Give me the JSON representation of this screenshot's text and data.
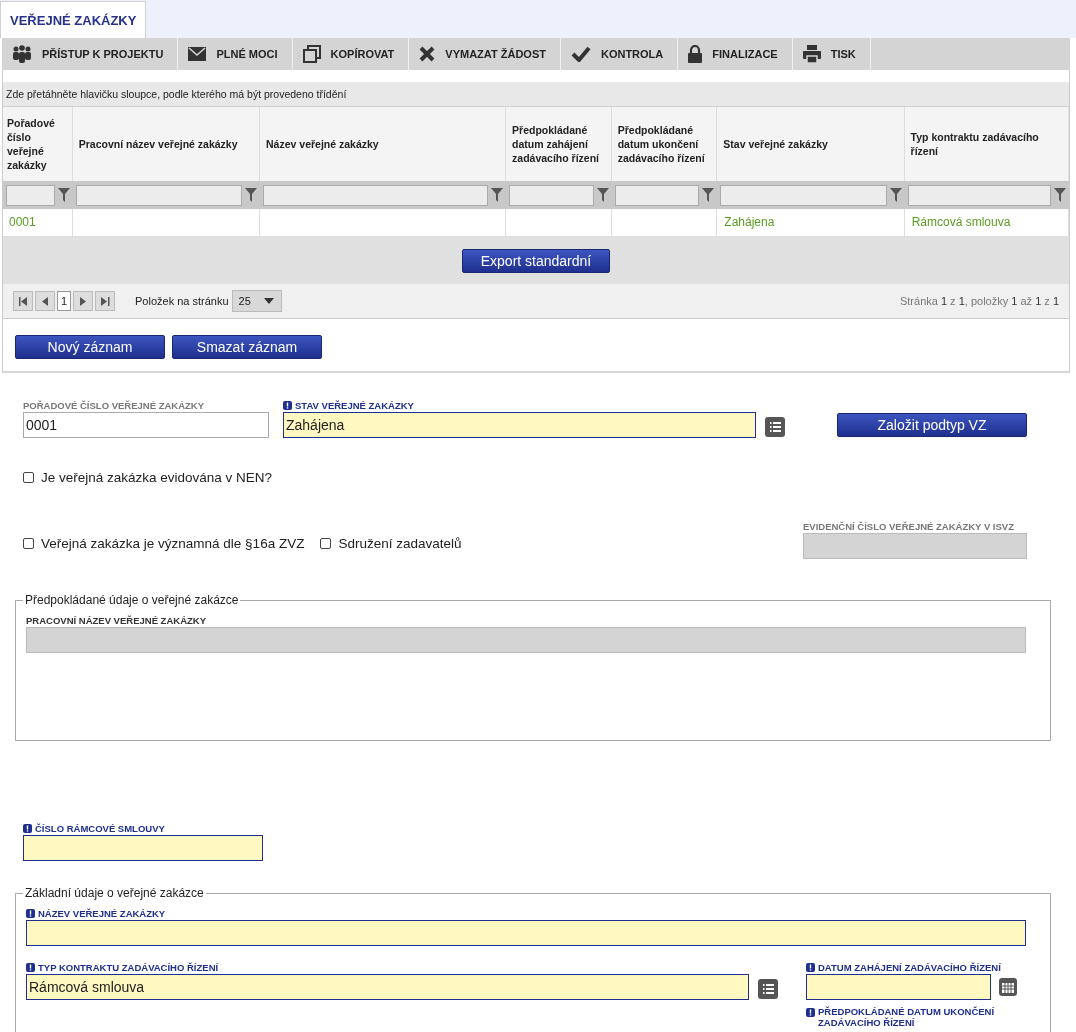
{
  "section_tab": {
    "label": "VEŘEJNÉ ZAKÁZKY",
    "selected": true
  },
  "toolbar": [
    {
      "label": "PŘÍSTUP K PROJEKTU",
      "kind": "people"
    },
    {
      "label": "PLNÉ MOCI",
      "kind": "mail"
    },
    {
      "label": "KOPÍROVAT",
      "kind": "copy"
    },
    {
      "label": "VYMAZAT ŽÁDOST",
      "kind": "delete"
    },
    {
      "label": "KONTROLA",
      "kind": "check"
    },
    {
      "label": "FINALIZACE",
      "kind": "lock"
    },
    {
      "label": "TISK",
      "kind": "print"
    }
  ],
  "grid": {
    "group_hint": "Zde přetáhněte hlavičku sloupce, podle kterého má být provedeno třídění",
    "columns": [
      "Pořadové číslo veřejné zakázky",
      "Pracovní název veřejné zakázky",
      "Název veřejné zakázky",
      "Předpokládané datum zahájení zadávacího řízení",
      "Předpokládané datum ukončení zadávacího řízení",
      "Stav veřejné zakázky",
      "Typ kontraktu zadávacího řízení"
    ],
    "rows": [
      [
        "0001",
        "",
        "",
        "",
        "",
        "Zahájena",
        "Rámcová smlouva"
      ]
    ],
    "export_button": "Export standardní",
    "pager": {
      "page": "1",
      "per_page_label": "Položek na stránku",
      "per_page": "25",
      "summary": "Stránka **1** z **1**, položky **1** až **1** z **1**"
    }
  },
  "actions": [
    "Nový záznam",
    "Smazat záznam"
  ],
  "form": {
    "order_number": {
      "label": "POŘADOVÉ ČÍSLO VEŘEJNÉ ZAKÁZKY",
      "value": "0001",
      "required": false
    },
    "status": {
      "label": "STAV VEŘEJNÉ ZAKÁZKY",
      "value": "Zahájena",
      "required": true
    },
    "subtype_button": "Založit podtyp VZ",
    "nen_checkbox": {
      "label": "Je veřejná zakázka evidována v NEN?",
      "checked": false
    },
    "significant_checkbox": {
      "label": "Veřejná zakázka je významná dle §16a ZVZ",
      "checked": false
    },
    "association_checkbox": {
      "label": "Sdružení zadavatelů",
      "checked": false
    },
    "isvz_number": {
      "label": "EVIDENČNÍ ČÍSLO VEŘEJNÉ ZAKÁZKY V ISVZ",
      "required": false
    },
    "expected_section": {
      "legend": "Předpokládané údaje o veřejné zakázce",
      "working_name": {
        "label": "PRACOVNÍ NÁZEV VEŘEJNÉ ZAKÁZKY",
        "required": false
      }
    },
    "framework_number": {
      "label": "ČÍSLO RÁMCOVÉ SMLOUVY",
      "required": true
    },
    "basic_section": {
      "legend": "Základní údaje o veřejné zakázce",
      "name": {
        "label": "NÁZEV VEŘEJNÉ ZAKÁZKY",
        "required": true
      },
      "contract_type": {
        "label": "TYP KONTRAKTU ZADÁVACÍHO ŘÍZENÍ",
        "value": "Rámcová smlouva",
        "required": true
      },
      "start_date": {
        "label": "DATUM ZAHÁJENÍ ZADÁVACÍHO ŘÍZENÍ",
        "required": true
      },
      "end_date": {
        "label": "PŘEDPOKLÁDANÉ DATUM UKONČENÍ ZADÁVACÍHO ŘÍZENÍ",
        "required": true
      }
    }
  }
}
